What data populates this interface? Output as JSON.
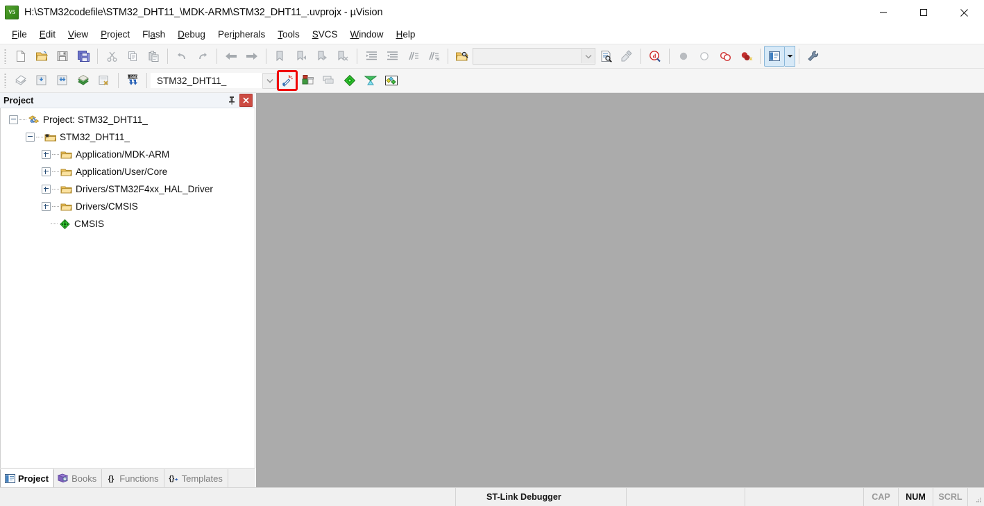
{
  "window": {
    "title": "H:\\STM32codefile\\STM32_DHT11_\\MDK-ARM\\STM32_DHT11_.uvprojx - µVision",
    "app_icon": "uvision-icon",
    "minimize_label": "minimize-icon",
    "maximize_label": "maximize-icon",
    "close_label": "close-icon"
  },
  "menubar": {
    "items": [
      {
        "label": "File",
        "accel": "F"
      },
      {
        "label": "Edit",
        "accel": "E"
      },
      {
        "label": "View",
        "accel": "V"
      },
      {
        "label": "Project",
        "accel": "P"
      },
      {
        "label": "Flash",
        "accel": "a"
      },
      {
        "label": "Debug",
        "accel": "D"
      },
      {
        "label": "Peripherals",
        "accel": "i"
      },
      {
        "label": "Tools",
        "accel": "T"
      },
      {
        "label": "SVCS",
        "accel": "S"
      },
      {
        "label": "Window",
        "accel": "W"
      },
      {
        "label": "Help",
        "accel": "H"
      }
    ]
  },
  "toolbar_main": {
    "buttons": [
      {
        "name": "new-file-icon",
        "tooltip": "New"
      },
      {
        "name": "open-file-icon",
        "tooltip": "Open"
      },
      {
        "name": "save-icon",
        "tooltip": "Save"
      },
      {
        "name": "save-all-icon",
        "tooltip": "Save All"
      },
      {
        "name": "cut-icon",
        "tooltip": "Cut"
      },
      {
        "name": "copy-icon",
        "tooltip": "Copy"
      },
      {
        "name": "paste-icon",
        "tooltip": "Paste"
      },
      {
        "name": "undo-icon",
        "tooltip": "Undo"
      },
      {
        "name": "redo-icon",
        "tooltip": "Redo"
      },
      {
        "name": "navigate-back-icon",
        "tooltip": "Back"
      },
      {
        "name": "navigate-forward-icon",
        "tooltip": "Forward"
      },
      {
        "name": "bookmark-toggle-icon",
        "tooltip": "Insert/Remove Bookmark"
      },
      {
        "name": "bookmark-prev-icon",
        "tooltip": "Go to Previous Bookmark"
      },
      {
        "name": "bookmark-next-icon",
        "tooltip": "Go to Next Bookmark"
      },
      {
        "name": "bookmark-clear-icon",
        "tooltip": "Clear All Bookmarks"
      },
      {
        "name": "indent-right-icon",
        "tooltip": "Indent Selected Text"
      },
      {
        "name": "indent-left-icon",
        "tooltip": "Unindent Selected Text"
      },
      {
        "name": "comment-icon",
        "tooltip": "Comment Selection"
      },
      {
        "name": "uncomment-icon",
        "tooltip": "Uncomment Selection"
      },
      {
        "name": "find-in-files-icon",
        "tooltip": "Find in Files"
      }
    ],
    "find_box": {
      "value": "",
      "placeholder": ""
    },
    "right_buttons": [
      {
        "name": "incremental-find-icon",
        "tooltip": "Find"
      },
      {
        "name": "replace-icon",
        "tooltip": "Replace"
      },
      {
        "name": "debug-session-icon",
        "tooltip": "Start/Stop Debug Session"
      },
      {
        "name": "breakpoint-insert-icon",
        "tooltip": "Insert/Remove Breakpoint"
      },
      {
        "name": "breakpoint-enable-icon",
        "tooltip": "Enable/Disable Breakpoint"
      },
      {
        "name": "breakpoint-disable-all-icon",
        "tooltip": "Disable All Breakpoints"
      },
      {
        "name": "breakpoint-kill-all-icon",
        "tooltip": "Kill All Breakpoints"
      },
      {
        "name": "window-layout-icon",
        "tooltip": "Manage Window Layout"
      },
      {
        "name": "chevron-down-icon",
        "tooltip": "More"
      },
      {
        "name": "configure-toolbar-icon",
        "tooltip": "Customize Tools"
      }
    ]
  },
  "toolbar_build": {
    "buttons": [
      {
        "name": "translate-file-icon",
        "tooltip": "Translate Current File"
      },
      {
        "name": "build-target-icon",
        "tooltip": "Build"
      },
      {
        "name": "rebuild-all-icon",
        "tooltip": "Rebuild"
      },
      {
        "name": "batch-build-icon",
        "tooltip": "Batch Build"
      },
      {
        "name": "stop-build-icon",
        "tooltip": "Stop Build"
      },
      {
        "name": "download-icon",
        "tooltip": "Download"
      }
    ],
    "target_selector": {
      "value": "STM32_DHT11_",
      "name": "target-selector"
    },
    "right_buttons": [
      {
        "name": "target-options-magic-wand-icon",
        "tooltip": "Options for Target",
        "highlighted": true
      },
      {
        "name": "manage-project-items-icon",
        "tooltip": "Manage Project Items"
      },
      {
        "name": "multi-project-icon",
        "tooltip": "Manage Multi-Project Workspace"
      },
      {
        "name": "run-to-main-icon",
        "tooltip": "Start Debug"
      },
      {
        "name": "pack-installer-icon",
        "tooltip": "Pack Installer"
      },
      {
        "name": "manage-run-time-environment-icon",
        "tooltip": "Manage Run-Time Environment"
      }
    ]
  },
  "project_panel": {
    "title": "Project",
    "pin_icon": "pin-icon",
    "close_icon": "close-icon",
    "tree": [
      {
        "label": "Project: STM32_DHT11_",
        "depth": 0,
        "expander": "minus",
        "icon": "project-icon"
      },
      {
        "label": "STM32_DHT11_",
        "depth": 1,
        "expander": "minus",
        "icon": "target-folder-icon"
      },
      {
        "label": "Application/MDK-ARM",
        "depth": 2,
        "expander": "plus",
        "icon": "group-folder-icon"
      },
      {
        "label": "Application/User/Core",
        "depth": 2,
        "expander": "plus",
        "icon": "group-folder-icon"
      },
      {
        "label": "Drivers/STM32F4xx_HAL_Driver",
        "depth": 2,
        "expander": "plus",
        "icon": "group-folder-icon"
      },
      {
        "label": "Drivers/CMSIS",
        "depth": 2,
        "expander": "plus",
        "icon": "group-folder-icon"
      },
      {
        "label": "CMSIS",
        "depth": 2,
        "expander": "none",
        "icon": "cmsis-component-icon"
      }
    ],
    "tabs": [
      {
        "label": "Project",
        "icon": "project-tab-icon",
        "selected": true
      },
      {
        "label": "Books",
        "icon": "books-tab-icon",
        "selected": false
      },
      {
        "label": "Functions",
        "icon": "functions-tab-icon",
        "selected": false
      },
      {
        "label": "Templates",
        "icon": "templates-tab-icon",
        "selected": false
      }
    ]
  },
  "statusbar": {
    "left": "",
    "blank_1": "",
    "debugger": "ST-Link Debugger",
    "blank_2": "",
    "blank_3": "",
    "caps": "CAP",
    "num": "NUM",
    "scroll": "SCRL"
  },
  "colors": {
    "client_background": "#ababab",
    "toolbar_background": "#f5f5f5",
    "panel_header": "#f1f4f8",
    "highlight_red": "#f00000",
    "close_button_red": "#cc4b43",
    "active_tool_blue": "#d7e9f7"
  }
}
